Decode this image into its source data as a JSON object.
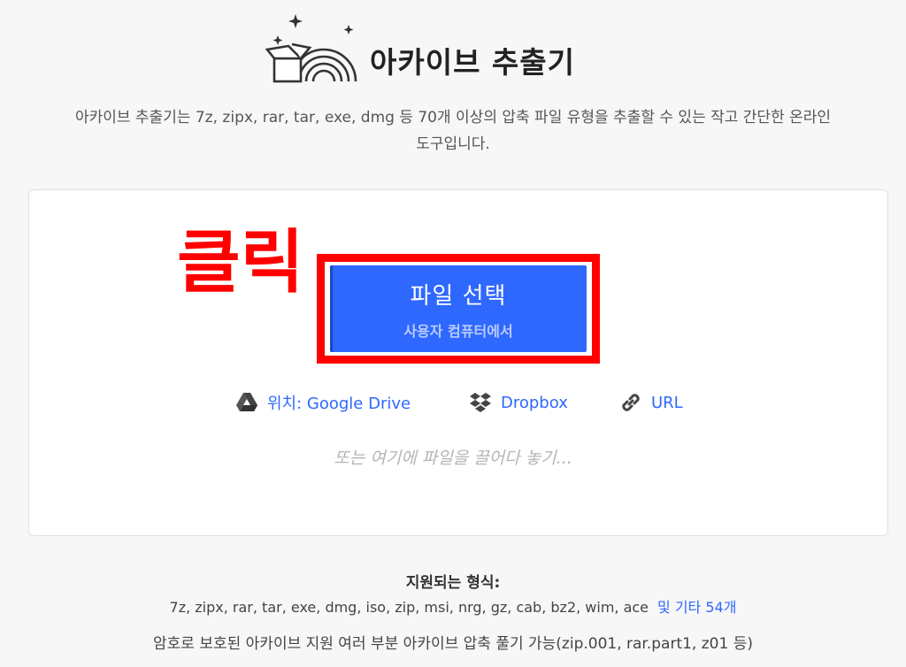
{
  "header": {
    "title": "아카이브 추출기",
    "description": "아카이브 추출기는 7z, zipx, rar, tar, exe, dmg 등 70개 이상의 압축 파일 유형을 추출할 수 있는 작고 간단한 온라인 도구입니다.",
    "logo_icon": "rainbow-box-logo-icon"
  },
  "annotation": {
    "label": "클릭",
    "color": "#ff0000"
  },
  "upload": {
    "button_label": "파일 선택",
    "button_sublabel": "사용자 컴퓨터에서",
    "button_color": "#2f68ff"
  },
  "sources": [
    {
      "label": "위치: Google Drive",
      "icon": "google-drive-icon"
    },
    {
      "label": "Dropbox",
      "icon": "dropbox-icon"
    },
    {
      "label": "URL",
      "icon": "link-icon"
    }
  ],
  "drop_hint": "또는 여기에 파일을 끌어다 놓기...",
  "formats": {
    "title": "지원되는 형식:",
    "list": "7z, zipx, rar, tar, exe, dmg, iso, zip, msi, nrg, gz, cab, bz2, wim, ace",
    "more_link": "및 기타 54개"
  },
  "features": "암호로 보호된 아카이브 지원 여러 부분 아카이브 압축 풀기 가능(zip.001, rar.part1, z01 등)"
}
